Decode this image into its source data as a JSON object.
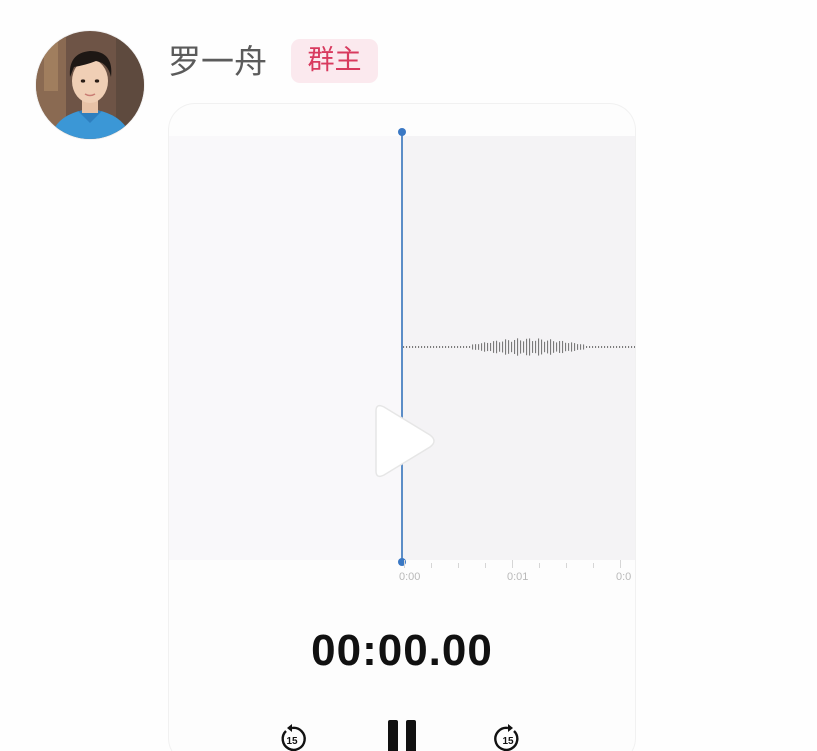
{
  "sender": {
    "name": "罗一舟",
    "role_badge": "群主",
    "avatar_icon": "user-avatar-photo"
  },
  "voice_card": {
    "tick_labels": [
      "0:00",
      "0:01",
      "0:0"
    ],
    "timer": "00:00.00",
    "skip_back_seconds": "15",
    "skip_forward_seconds": "15",
    "playback_progress": 0,
    "icons": {
      "play": "play-icon",
      "pause": "pause-icon",
      "skip_back": "skip-back-15-icon",
      "skip_forward": "skip-forward-15-icon"
    },
    "colors": {
      "playhead": "#3a78c4",
      "badge_text": "#d83a5e",
      "badge_bg": "#fbe9ee"
    }
  }
}
